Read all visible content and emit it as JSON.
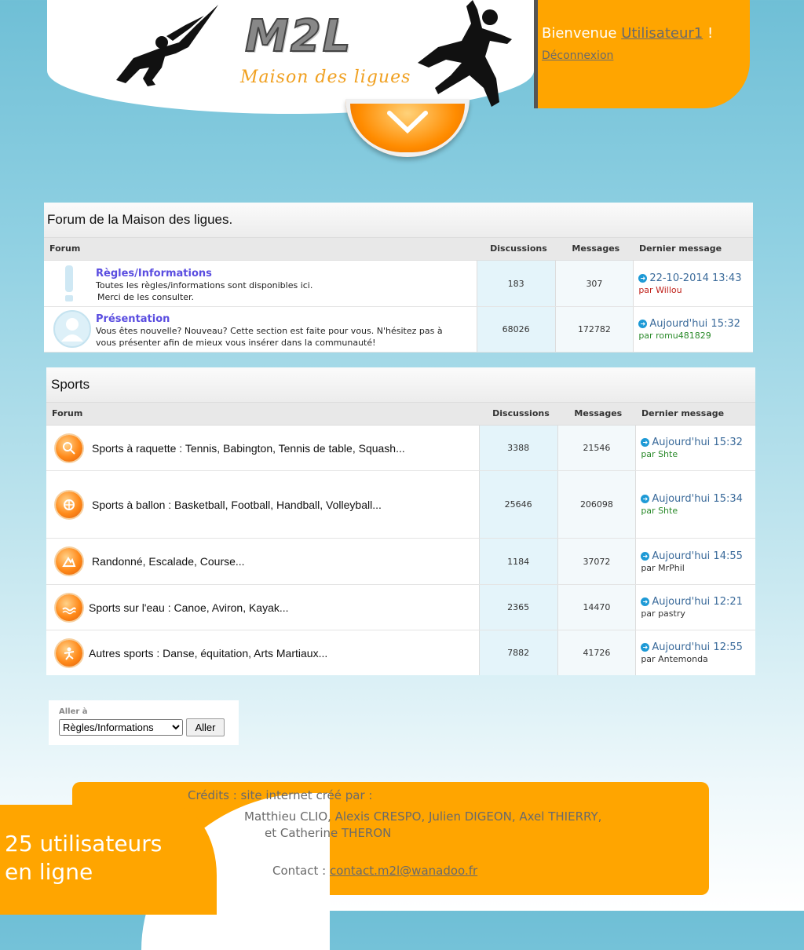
{
  "header": {
    "logo_text": "M2L",
    "tagline": "Maison des ligues",
    "welcome_prefix": "Bienvenue",
    "username": "Utilisateur1",
    "welcome_suffix": " !",
    "logout": "Déconnexion",
    "colors": {
      "accent": "#ffa500",
      "link_purple": "#5a4de0"
    }
  },
  "forum_block": {
    "title": "Forum de la Maison des ligues.",
    "headers": {
      "forum": "Forum",
      "discussions": "Discussions",
      "messages": "Messages",
      "last": "Dernier message"
    },
    "rows": [
      {
        "title": "Règles/Informations",
        "desc1": "Toutes les règles/informations sont disponibles ici.",
        "desc2": "Merci de les consulter.",
        "discussions": "183",
        "messages": "307",
        "when": "22-10-2014 13:43",
        "by": "par Willou",
        "by_color": "#c0221b",
        "icon": "exclamation-icon"
      },
      {
        "title": "Présentation",
        "desc1": "Vous êtes nouvelle? Nouveau? Cette section est faite pour vous. N'hésitez pas à",
        "desc2": "vous présenter afin de mieux vous insérer dans la communauté!",
        "discussions": "68026",
        "messages": "172782",
        "when": "Aujourd'hui 15:32",
        "by": "par romu481829",
        "by_color": "#2a8a2a",
        "icon": "user-avatar-icon"
      }
    ]
  },
  "sports_block": {
    "title": "Sports",
    "headers": {
      "forum": "Forum",
      "discussions": "Discussions",
      "messages": "Messages",
      "last": "Dernier message"
    },
    "rows": [
      {
        "label": "Sports à raquette : Tennis, Babington, Tennis de table, Squash...",
        "discussions": "3388",
        "messages": "21546",
        "when": "Aujourd'hui 15:32",
        "by": "par Shte",
        "by_color": "#2a8a2a"
      },
      {
        "label": "Sports à ballon : Basketball, Football, Handball, Volleyball...",
        "discussions": "25646",
        "messages": "206098",
        "when": "Aujourd'hui 15:34",
        "by": "par Shte",
        "by_color": "#2a8a2a"
      },
      {
        "label": "Randonné, Escalade, Course...",
        "discussions": "1184",
        "messages": "37072",
        "when": "Aujourd'hui 14:55",
        "by": "par MrPhil",
        "by_color": "#333333"
      },
      {
        "label": "Sports sur l'eau : Canoe, Aviron, Kayak...",
        "discussions": "2365",
        "messages": "14470",
        "when": "Aujourd'hui 12:21",
        "by": "par pastry",
        "by_color": "#333333"
      },
      {
        "label": "Autres sports : Danse, équitation, Arts Martiaux...",
        "discussions": "7882",
        "messages": "41726",
        "when": "Aujourd'hui 12:55",
        "by": "par Antemonda",
        "by_color": "#333333"
      }
    ]
  },
  "jump": {
    "label": "Aller à",
    "selected": "Règles/Informations",
    "button": "Aller"
  },
  "footer": {
    "credits_title": "Crédits : site internet créé par :",
    "credits_line1": "Matthieu CLIO, Alexis CRESPO, Julien DIGEON, Axel THIERRY,",
    "credits_line2": "et Catherine THERON",
    "contact_label": "Contact : ",
    "contact_email": "contact.m2l@wanadoo.fr",
    "online_line1": "25 utilisateurs",
    "online_line2": "en ligne"
  }
}
